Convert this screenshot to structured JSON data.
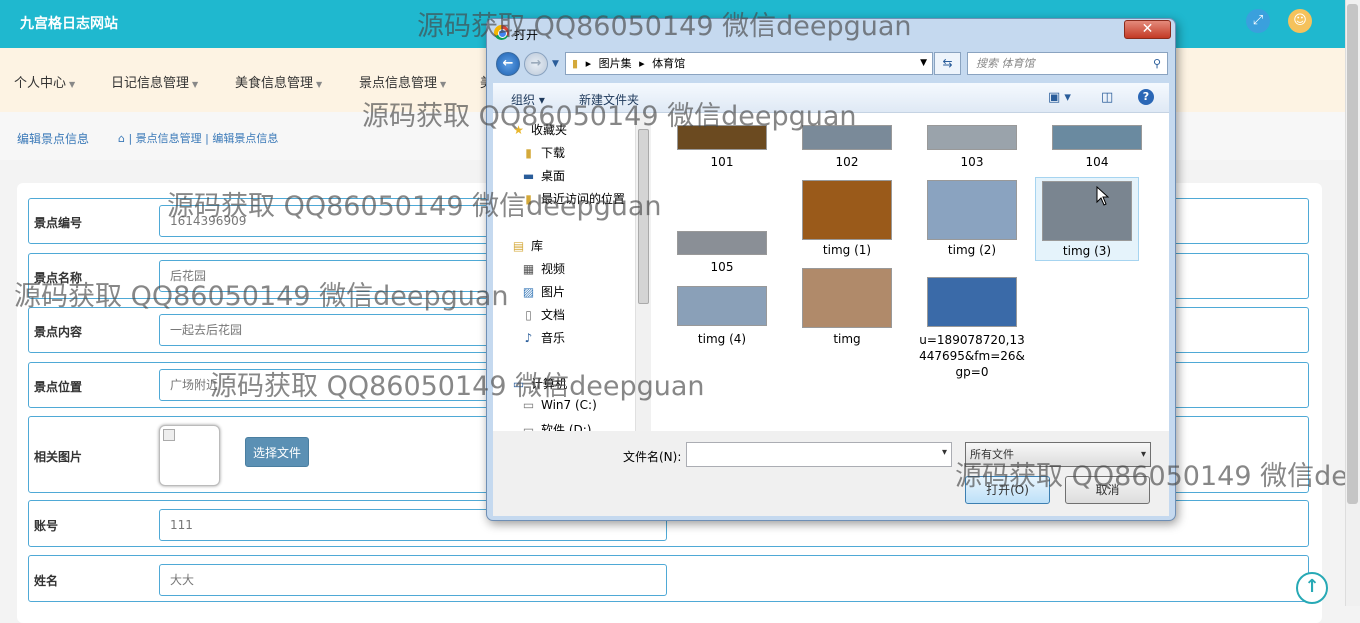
{
  "header": {
    "brand": "九宫格日志网站",
    "fullscreen_icon": "expand-icon",
    "user_icon": "user-icon"
  },
  "menu": [
    {
      "label": "个人中心"
    },
    {
      "label": "日记信息管理"
    },
    {
      "label": "美食信息管理"
    },
    {
      "label": "景点信息管理"
    },
    {
      "label": "美"
    }
  ],
  "breadcrumb": {
    "title": "编辑景点信息",
    "path": "⌂ | 景点信息管理 | 编辑景点信息"
  },
  "form": {
    "fields": [
      {
        "label": "景点编号",
        "value": "1614396909"
      },
      {
        "label": "景点名称",
        "value": "后花园"
      },
      {
        "label": "景点内容",
        "value": "一起去后花园"
      },
      {
        "label": "景点位置",
        "value": "广场附近"
      },
      {
        "label": "相关图片",
        "button": "选择文件"
      },
      {
        "label": "账号",
        "value": "111"
      },
      {
        "label": "姓名",
        "value": "大大"
      }
    ]
  },
  "dialog": {
    "title": "打开",
    "close": "✕",
    "address": [
      "图片集",
      "体育馆"
    ],
    "search_placeholder": "搜索 体育馆",
    "organize": "组织 ▾",
    "new_folder": "新建文件夹",
    "tree": [
      {
        "label": "收藏夹",
        "icon": "star-icon"
      },
      {
        "label": "下载",
        "icon": "download-folder-icon"
      },
      {
        "label": "桌面",
        "icon": "desktop-icon"
      },
      {
        "label": "最近访问的位置",
        "icon": "recent-places-icon"
      },
      {
        "label": "库",
        "icon": "library-icon"
      },
      {
        "label": "视频",
        "icon": "video-icon"
      },
      {
        "label": "图片",
        "icon": "pictures-icon"
      },
      {
        "label": "文档",
        "icon": "documents-icon"
      },
      {
        "label": "音乐",
        "icon": "music-icon"
      },
      {
        "label": "计算机",
        "icon": "computer-icon"
      },
      {
        "label": "Win7 (C:)",
        "icon": "drive-icon"
      },
      {
        "label": "软件 (D:)",
        "icon": "drive-icon"
      }
    ],
    "files": [
      {
        "name": "101",
        "color": "#6b4a20"
      },
      {
        "name": "102",
        "color": "#7a8a99"
      },
      {
        "name": "103",
        "color": "#9aa3ab"
      },
      {
        "name": "104",
        "color": "#6a8aa0"
      },
      {
        "name": "105",
        "color": "#8a8f96"
      },
      {
        "name": "timg (1)",
        "color": "#9a5a1a"
      },
      {
        "name": "timg (2)",
        "color": "#8aa3c0"
      },
      {
        "name": "timg (3)",
        "color": "#7a8590"
      },
      {
        "name": "timg (4)",
        "color": "#8aa0b8"
      },
      {
        "name": "timg",
        "color": "#b08a6a"
      },
      {
        "name": "u=189078720,13447695&fm=26&gp=0",
        "color": "#3a6aa8"
      }
    ],
    "filename_label": "文件名(N):",
    "filetype": "所有文件",
    "open": "打开(O)",
    "cancel": "取消"
  },
  "watermark": "源码获取 QQ86050149 微信deepguan"
}
